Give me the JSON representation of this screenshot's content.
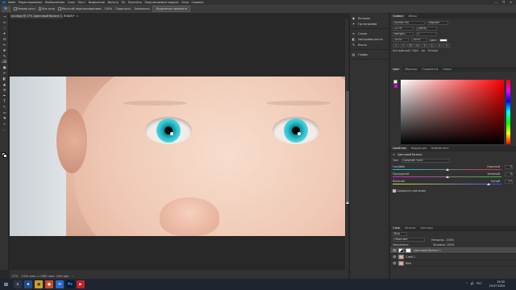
{
  "menu": {
    "app_badge": "Ps",
    "items": [
      "Файл",
      "Редактирование",
      "Изображение",
      "Слои",
      "Текст",
      "Выделение",
      "Фильтр",
      "3D",
      "Просмотр",
      "Подключаемые модули",
      "Окно",
      "Справка"
    ]
  },
  "window_controls": [
    "—",
    "❐",
    "✕"
  ],
  "options": {
    "tool_glyph": "🔍",
    "zoom_value": "100%",
    "items": [
      {
        "label": "Размер окон",
        "has_checkbox": true,
        "has_box": false
      },
      {
        "label": "Все окна",
        "has_checkbox": true,
        "has_box": false
      },
      {
        "label": "Масштаб перетаскиванием",
        "has_checkbox": true,
        "has_box": false
      },
      {
        "label": "100%",
        "has_checkbox": false,
        "has_box": false
      },
      {
        "label": "Подогнать",
        "has_checkbox": false,
        "has_box": false
      },
      {
        "label": "Заполнить",
        "has_checkbox": false,
        "has_box": false
      }
    ],
    "button": "Выделение предмета"
  },
  "document_tab": {
    "title": "ancelpg @ 27% (Цветовой баланс 1, RGB/8)*",
    "close": "×"
  },
  "tools": [
    "⇢",
    "▭",
    "◌",
    "✦",
    "⊡",
    "✂",
    "✥",
    "✎",
    "⌫",
    "▣",
    "✍",
    "◧",
    "▲",
    "◔",
    "✒",
    "T",
    "↖",
    "▭",
    "☚",
    "⌕",
    "…"
  ],
  "status": [
    "27%",
    "1920 пикс. x 1080 пикс. (300 ppi)",
    "›"
  ],
  "side_panel": {
    "group1": [
      {
        "icon": "◉",
        "label": "История"
      },
      {
        "icon": "✦",
        "label": "Гистограмма"
      }
    ],
    "group2": [
      {
        "icon": "≡",
        "label": "Стили"
      },
      {
        "icon": "◧",
        "label": "Настройки кисти"
      },
      {
        "icon": "✎",
        "label": "Кисти"
      }
    ],
    "group3": [
      {
        "icon": "▤",
        "label": "Глифы"
      }
    ]
  },
  "character": {
    "tabs": [
      "Символ",
      "Абзац"
    ],
    "font": "Myriad Pro",
    "style": "Regular",
    "size": "12 пт",
    "leading": "(Авто)",
    "tracking": "0",
    "kerning": "Метрич.",
    "scale": "100%",
    "color_label": "Цвет:",
    "format_buttons": [
      "T",
      "T",
      "TT",
      "Tт",
      "T¹",
      "T₁",
      "T",
      "T"
    ],
    "footer": [
      "Английский: США",
      "aa",
      "Резкое"
    ]
  },
  "color_panel": {
    "tabs": [
      "Цвет",
      "Образцы",
      "Градиенты",
      "Узоры"
    ]
  },
  "properties": {
    "tabs": [
      "Свойства",
      "Коррекция",
      "Библиотеки"
    ],
    "title": "Цветовой баланс",
    "tone_label": "Тон:",
    "tone_value": "Средние тона",
    "sliders": [
      {
        "left": "Голубой",
        "right": "Красный",
        "value": "0",
        "position": 0.5,
        "color_left": "#00c8d8",
        "color_right": "#e03030"
      },
      {
        "left": "Пурпурный",
        "right": "Зеленый",
        "value": "0",
        "position": 0.5,
        "color_left": "#e020d0",
        "color_right": "#30c030"
      },
      {
        "left": "Желтый",
        "right": "Синий",
        "value": "+7",
        "position": 0.88,
        "color_left": "#e0e020",
        "color_right": "#3050ff"
      }
    ],
    "preserve_label": "Сохранить свечение"
  },
  "layers": {
    "tabs": [
      "Слои",
      "Каналы",
      "Контуры"
    ],
    "kind": "Вид",
    "mode": "Обычные",
    "opacity": "Непрозр.: 100%",
    "fill": "Заливка: 100%",
    "lock": "Закрепить:",
    "rows": [
      {
        "name": "Цветовой баланс 1",
        "selected": true,
        "thumb": "adjust"
      },
      {
        "name": "Слой 1",
        "selected": false,
        "thumb": "photo"
      },
      {
        "name": "Фон",
        "selected": false,
        "thumb": "photo"
      }
    ]
  },
  "taskbar": {
    "start": "⊞",
    "apps": [
      {
        "label": "⌕",
        "color": "#2c3442",
        "text": "#ddd"
      },
      {
        "label": "e",
        "color": "#1e4f8c",
        "text": "#fff"
      },
      {
        "label": "▣",
        "color": "#c9a227",
        "text": "#222"
      },
      {
        "label": "●",
        "color": "#d04a2a",
        "text": "#fff"
      },
      {
        "label": "✉",
        "color": "#2a6acb",
        "text": "#fff"
      },
      {
        "label": "Ps",
        "color": "#0a1a33",
        "text": "#31a8ff"
      },
      {
        "label": "▶",
        "color": "#c82020",
        "text": "#fff"
      }
    ],
    "tray": [
      "^",
      "🔊",
      "РУС"
    ],
    "time": "19:32",
    "date": "23.07.2024"
  }
}
